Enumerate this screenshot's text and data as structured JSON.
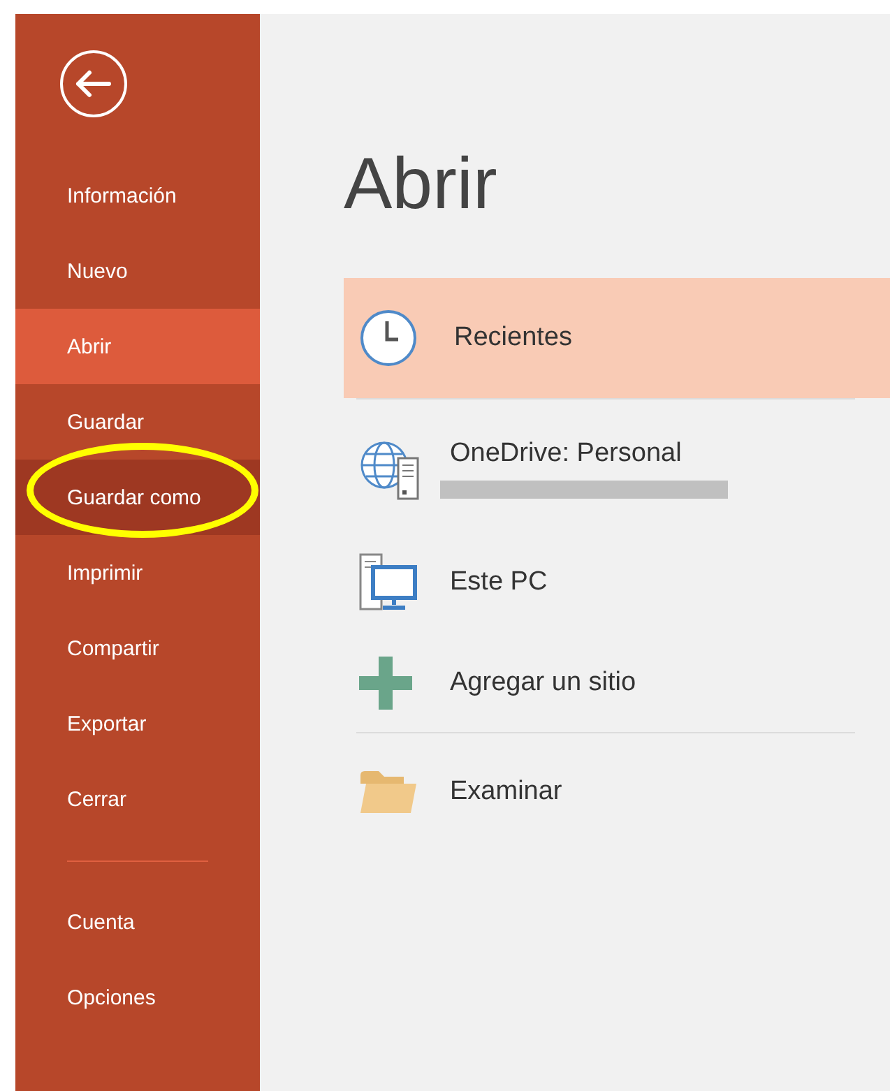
{
  "sidebar": {
    "items": [
      {
        "kind": "item",
        "label": "Información",
        "selected": false,
        "hovered": false,
        "circled": false
      },
      {
        "kind": "item",
        "label": "Nuevo",
        "selected": false,
        "hovered": false,
        "circled": false
      },
      {
        "kind": "item",
        "label": "Abrir",
        "selected": true,
        "hovered": false,
        "circled": false
      },
      {
        "kind": "item",
        "label": "Guardar",
        "selected": false,
        "hovered": false,
        "circled": false
      },
      {
        "kind": "item",
        "label": "Guardar como",
        "selected": false,
        "hovered": true,
        "circled": true
      },
      {
        "kind": "item",
        "label": "Imprimir",
        "selected": false,
        "hovered": false,
        "circled": false
      },
      {
        "kind": "item",
        "label": "Compartir",
        "selected": false,
        "hovered": false,
        "circled": false
      },
      {
        "kind": "item",
        "label": "Exportar",
        "selected": false,
        "hovered": false,
        "circled": false
      },
      {
        "kind": "item",
        "label": "Cerrar",
        "selected": false,
        "hovered": false,
        "circled": false
      },
      {
        "kind": "separator"
      },
      {
        "kind": "item",
        "label": "Cuenta",
        "selected": false,
        "hovered": false,
        "circled": false
      },
      {
        "kind": "item",
        "label": "Opciones",
        "selected": false,
        "hovered": false,
        "circled": false
      }
    ]
  },
  "page": {
    "title": "Abrir"
  },
  "locations": [
    {
      "kind": "clock",
      "label": "Recientes",
      "selected": true
    },
    {
      "kind": "separator"
    },
    {
      "kind": "cloud",
      "label": "OneDrive: Personal",
      "selected": false,
      "redacted_subtitle": true
    },
    {
      "kind": "pc",
      "label": "Este PC",
      "selected": false
    },
    {
      "kind": "add",
      "label": "Agregar un sitio",
      "selected": false
    },
    {
      "kind": "separator"
    },
    {
      "kind": "folder",
      "label": "Examinar",
      "selected": false
    }
  ]
}
